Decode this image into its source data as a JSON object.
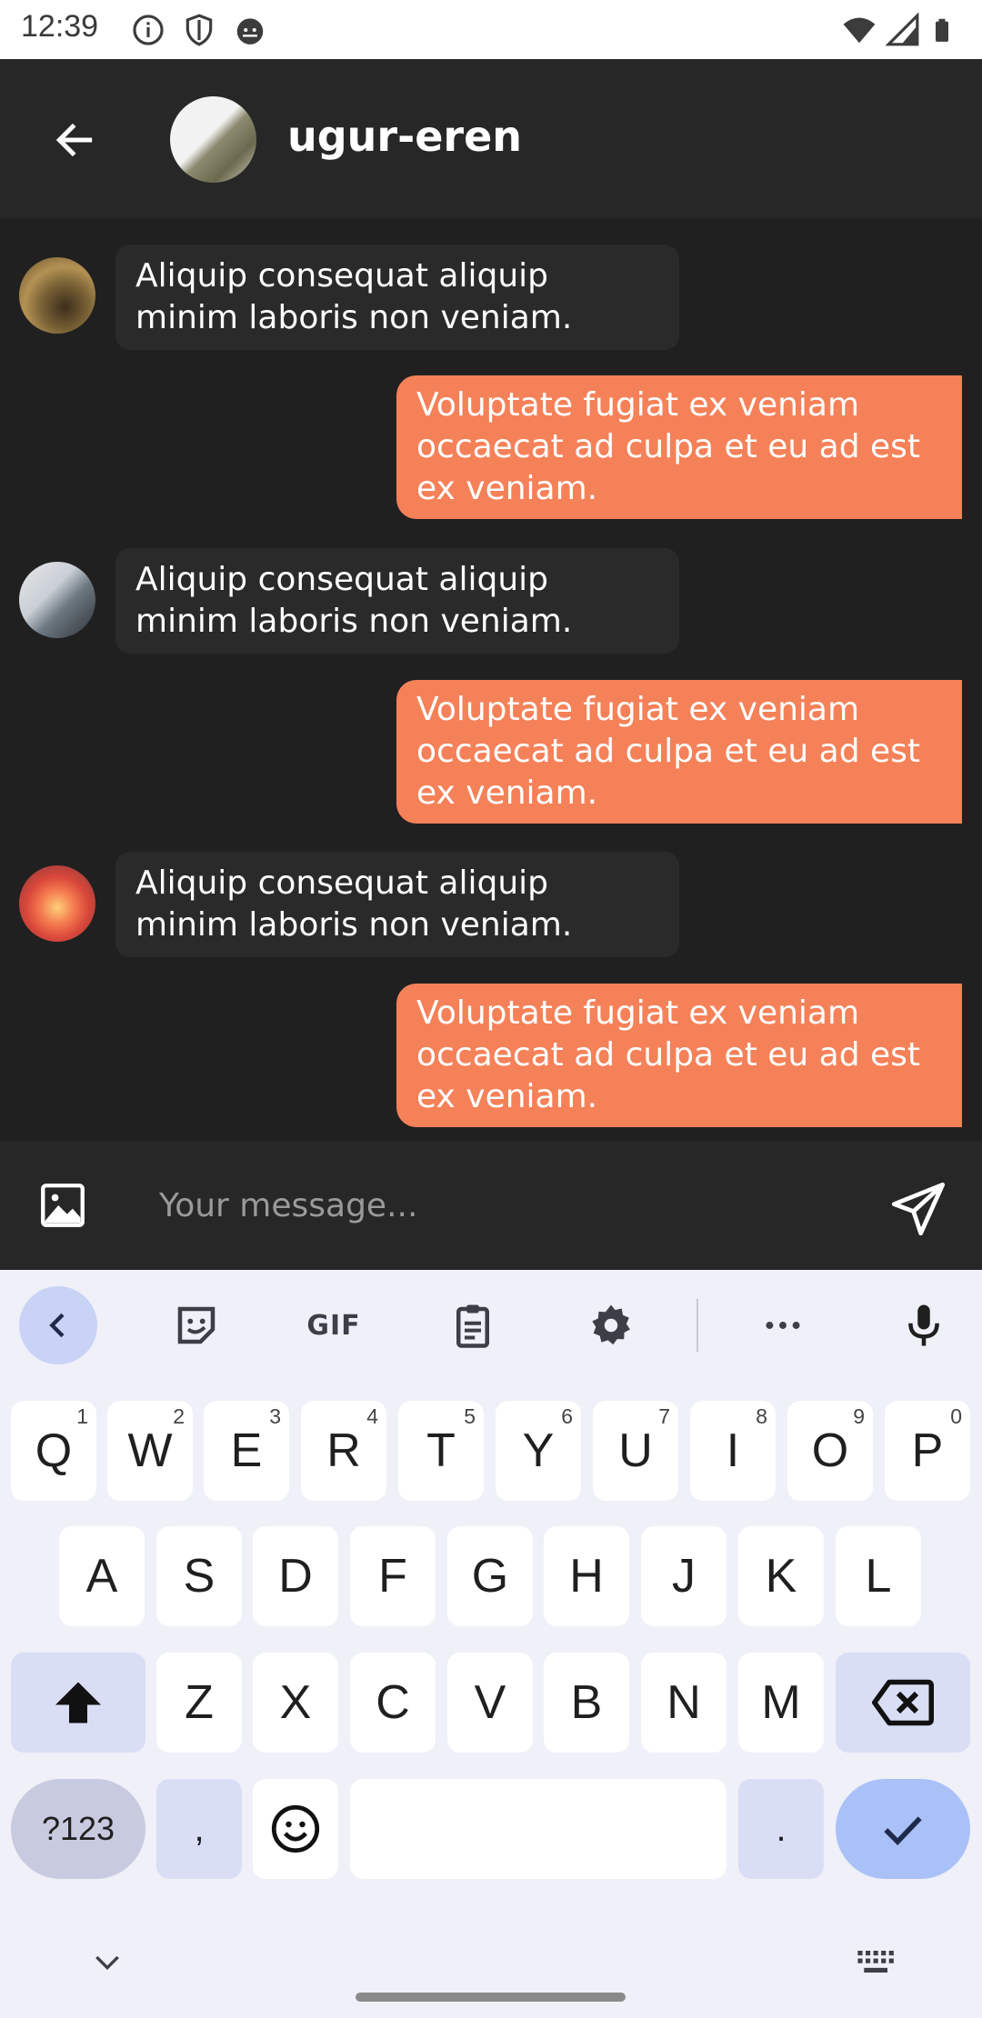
{
  "status_bar": {
    "time": "12:39",
    "left_icons": [
      "info-icon",
      "shield-icon",
      "android-debug-icon"
    ],
    "right_icons": [
      "wifi-icon",
      "cell-signal-icon",
      "battery-icon"
    ]
  },
  "header": {
    "back_icon": "arrow-left-icon",
    "name": "ugur-eren"
  },
  "messages": [
    {
      "direction": "incoming",
      "text": "Aliquip consequat aliquip minim laboris non veniam."
    },
    {
      "direction": "outgoing",
      "text": "Voluptate fugiat ex veniam occaecat ad culpa et eu ad est ex veniam."
    },
    {
      "direction": "incoming",
      "text": "Aliquip consequat aliquip minim laboris non veniam."
    },
    {
      "direction": "outgoing",
      "text": "Voluptate fugiat ex veniam occaecat ad culpa et eu ad est ex veniam."
    },
    {
      "direction": "incoming",
      "text": "Aliquip consequat aliquip minim laboris non veniam."
    },
    {
      "direction": "outgoing",
      "text": "Voluptate fugiat ex veniam occaecat ad culpa et eu ad est ex veniam."
    }
  ],
  "composer": {
    "placeholder": "Your message...",
    "value": "",
    "image_icon": "image-icon",
    "send_icon": "send-icon"
  },
  "keyboard": {
    "toolbar": {
      "gif_label": "GIF",
      "icons": [
        "chevron-left-icon",
        "sticker-icon",
        "gif-icon",
        "clipboard-icon",
        "settings-icon",
        "more-icon",
        "mic-icon"
      ]
    },
    "row1": [
      {
        "label": "Q",
        "hint": "1"
      },
      {
        "label": "W",
        "hint": "2"
      },
      {
        "label": "E",
        "hint": "3"
      },
      {
        "label": "R",
        "hint": "4"
      },
      {
        "label": "T",
        "hint": "5"
      },
      {
        "label": "Y",
        "hint": "6"
      },
      {
        "label": "U",
        "hint": "7"
      },
      {
        "label": "I",
        "hint": "8"
      },
      {
        "label": "O",
        "hint": "9"
      },
      {
        "label": "P",
        "hint": "0"
      }
    ],
    "row2": [
      "A",
      "S",
      "D",
      "F",
      "G",
      "H",
      "J",
      "K",
      "L"
    ],
    "row3": [
      "Z",
      "X",
      "C",
      "V",
      "B",
      "N",
      "M"
    ],
    "row4": {
      "symbols_label": "?123",
      "comma_label": ",",
      "period_label": "."
    }
  },
  "colors": {
    "app_bar": "#272727",
    "chat_bg": "#202020",
    "incoming_bubble": "#2a2a2a",
    "outgoing_bubble": "#f58159",
    "keyboard_bg": "#eff0f8"
  }
}
